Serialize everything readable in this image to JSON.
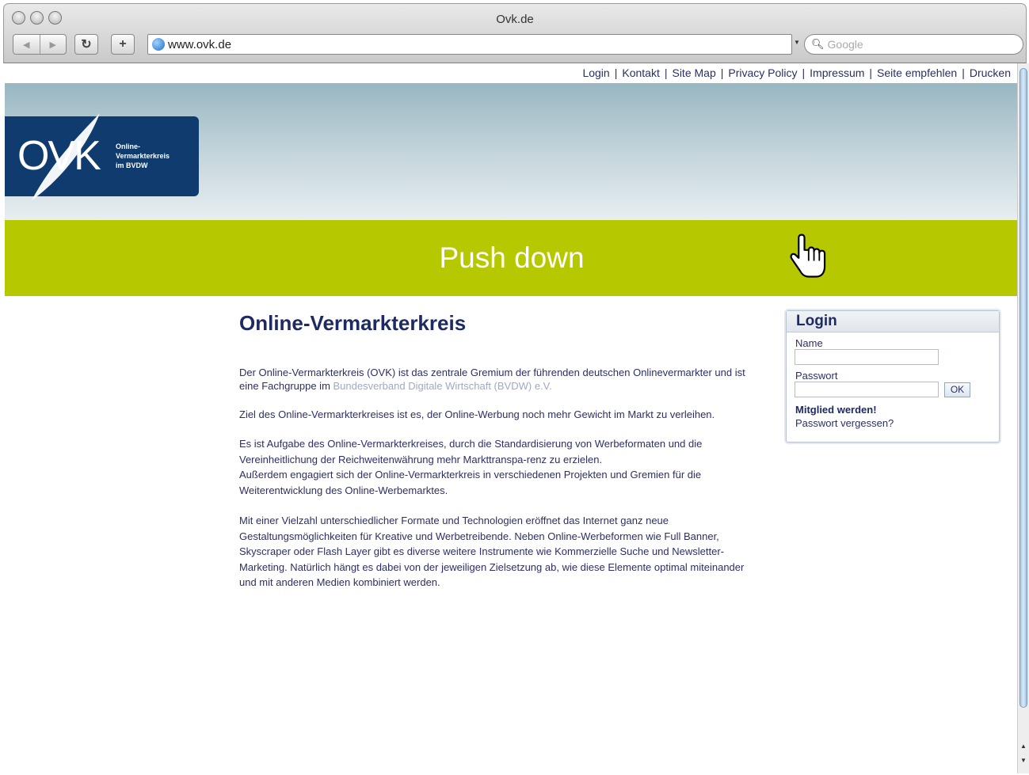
{
  "browser": {
    "window_title": "Ovk.de",
    "url": "www.ovk.de",
    "search_placeholder": "Google"
  },
  "top_links": [
    "Login",
    "Kontakt",
    "Site Map",
    "Privacy Policy",
    "Impressum",
    "Seite empfehlen",
    "Drucken"
  ],
  "logo": {
    "text": "OVK",
    "subline_1": "Online-",
    "subline_2": "Vermarkterkreis",
    "subline_3": "im BVDW"
  },
  "banner": {
    "text": "Push down"
  },
  "main": {
    "title": "Online-Vermarkterkreis",
    "p1_text": "Der Online-Vermarkterkreis (OVK) ist das zentrale Gremium der führenden deutschen Onlinevermarkter und ist eine Fachgruppe im ",
    "p1_link": "Bundesverband Digitale Wirtschaft (BVDW) e.V.",
    "p2": "Ziel des Online-Vermarkterkreises ist es, der Online-Werbung noch mehr Gewicht im Markt zu verleihen.",
    "p3": "Es ist Aufgabe des Online-Vermarkterkreises, durch die Standardisierung von Werbeformaten und die Vereinheitlichung der Reichweitenwährung mehr Markttranspa-renz zu erzielen.",
    "p4": "Außerdem engagiert sich der Online-Vermarkterkreis in verschiedenen Projekten und Gremien für die Weiterentwicklung des Online-Werbemarktes.",
    "p5": "Mit einer Vielzahl unterschiedlicher Formate und Technologien eröffnet das Internet ganz neue Gestaltungsmöglichkeiten für Kreative und Werbetreibende. Neben Online-Werbeformen wie Full Banner, Skyscraper oder Flash Layer gibt es diverse weitere Instrumente wie Kommerzielle Suche und Newsletter-Marketing. Natürlich hängt es dabei von der jeweiligen Zielsetzung ab, wie diese Elemente optimal miteinander und mit anderen Medien kombiniert werden."
  },
  "login_box": {
    "title": "Login",
    "name_label": "Name",
    "password_label": "Passwort",
    "ok_label": "OK",
    "member_link": "Mitglied werden!",
    "forgot_link": "Passwort vergessen?"
  },
  "colors": {
    "banner": "#b5c800",
    "logo_bg": "#0f3b6e",
    "text": "#2d2f66"
  }
}
